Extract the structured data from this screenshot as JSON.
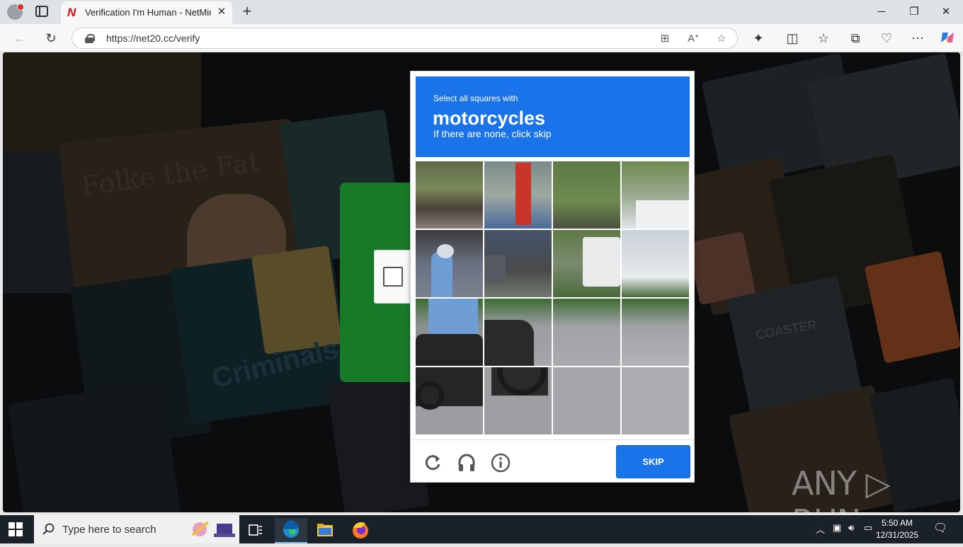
{
  "browser": {
    "tab_title": "Verification I'm Human - NetMirror",
    "tab_favicon": "N",
    "close_tab_glyph": "✕",
    "new_tab_glyph": "+",
    "url": "https://net20.cc/verify",
    "window_controls": {
      "minimize": "─",
      "maximize": "❐",
      "close": "✕"
    }
  },
  "page": {
    "poster_text_1": "Folke the Fat",
    "poster_text_2": "Criminals And Agents",
    "poster_text_3": "COASTER",
    "watermark": "ANY ▷ RUN"
  },
  "captcha": {
    "instruction_small": "Select all squares with",
    "target": "motorcycles",
    "instruction_sub": "If there are none, click skip",
    "skip_label": "SKIP",
    "icons": [
      "refresh-icon",
      "headphones-icon",
      "info-icon"
    ]
  },
  "taskbar": {
    "search_placeholder": "Type here to search",
    "time": "5:50 AM",
    "date": "12/31/2025"
  },
  "colors": {
    "captcha_blue": "#1a73e8",
    "verify_green": "#177a28",
    "taskbar": "#1b2128"
  }
}
